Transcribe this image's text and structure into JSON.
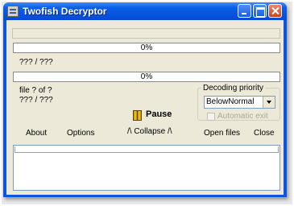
{
  "window": {
    "title": "Twofish Decryptor"
  },
  "progress": {
    "file_label": "0%",
    "file_fraction": 0,
    "file_count": "??? / ???",
    "total_label": "0%",
    "total_fraction": 0,
    "file_index": "file ? of ?",
    "total_count": "??? / ???"
  },
  "priority": {
    "legend": "Decoding priority",
    "selected": "BelowNormal",
    "auto_exit_label": "Automatic exit",
    "auto_exit_checked": false
  },
  "actions": {
    "pause": "Pause",
    "about": "About",
    "options": "Options",
    "collapse": "/\\ Collapse /\\",
    "open_files": "Open files",
    "close": "Close"
  }
}
